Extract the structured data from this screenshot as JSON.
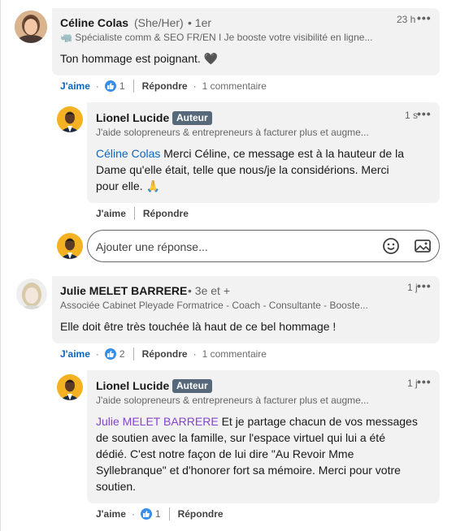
{
  "comments": [
    {
      "author": "Céline Colas",
      "pronouns": "(She/Her)",
      "degree": "• 1er",
      "headline": "🦏 Spécialiste comm & SEO FR/EN I Je booste votre visibilité en ligne...",
      "time": "23 h",
      "text": "Ton hommage est poignant. 🖤",
      "like_label": "J'aime",
      "reaction_count": "1",
      "reply_label": "Répondre",
      "replies_count": "1 commentaire"
    },
    {
      "author": "Julie MELET BARRERE",
      "degree": "• 3e et +",
      "headline": "Associée Cabinet Pleyade Formatrice - Coach - Consultante - Booste...",
      "time": "1 j",
      "text": "Elle doit être très touchée là haut de ce bel hommage !",
      "like_label": "J'aime",
      "reaction_count": "2",
      "reply_label": "Répondre",
      "replies_count": "1 commentaire"
    }
  ],
  "replies": [
    {
      "author": "Lionel Lucide",
      "badge": "Auteur",
      "headline": "J'aide solopreneurs & entrepreneurs à facturer plus et augme...",
      "time": "1 s",
      "mention": "Céline Colas",
      "text_line1": " Merci Céline, ce message est à la hauteur de la",
      "text_line2": "Dame qu'elle était, telle que nous/je la considérions. Merci",
      "text_line3": "pour elle. 🙏",
      "like_label": "J'aime",
      "reply_label": "Répondre"
    },
    {
      "author": "Lionel Lucide",
      "badge": "Auteur",
      "headline": "J'aide solopreneurs & entrepreneurs à facturer plus et augme...",
      "time": "1 j",
      "mention": "Julie MELET BARRERE",
      "text_line1": " Et je partage chacun de vos messages",
      "text_line2": "de soutien avec la famille, sur l'espace virtuel qui lui a été",
      "text_line3": "dédié. C'est notre façon de lui dire \"Au Revoir Mme",
      "text_line4": "Syllebranque\" et d'honorer fort sa mémoire. Merci pour votre",
      "text_line5": "soutien.",
      "like_label": "J'aime",
      "reaction_count": "1",
      "reply_label": "Répondre"
    }
  ],
  "reply_input": {
    "placeholder": "Ajouter une réponse..."
  },
  "icons": {
    "more": "more-horizontal-icon",
    "emoji": "emoji-icon",
    "image": "image-icon",
    "reaction": "like-reaction-icon"
  },
  "colors": {
    "brand_blue": "#0a66c2",
    "visited_mention": "#8344cc",
    "badge_bg": "#56687a",
    "bubble_bg": "#f2f2f2"
  }
}
